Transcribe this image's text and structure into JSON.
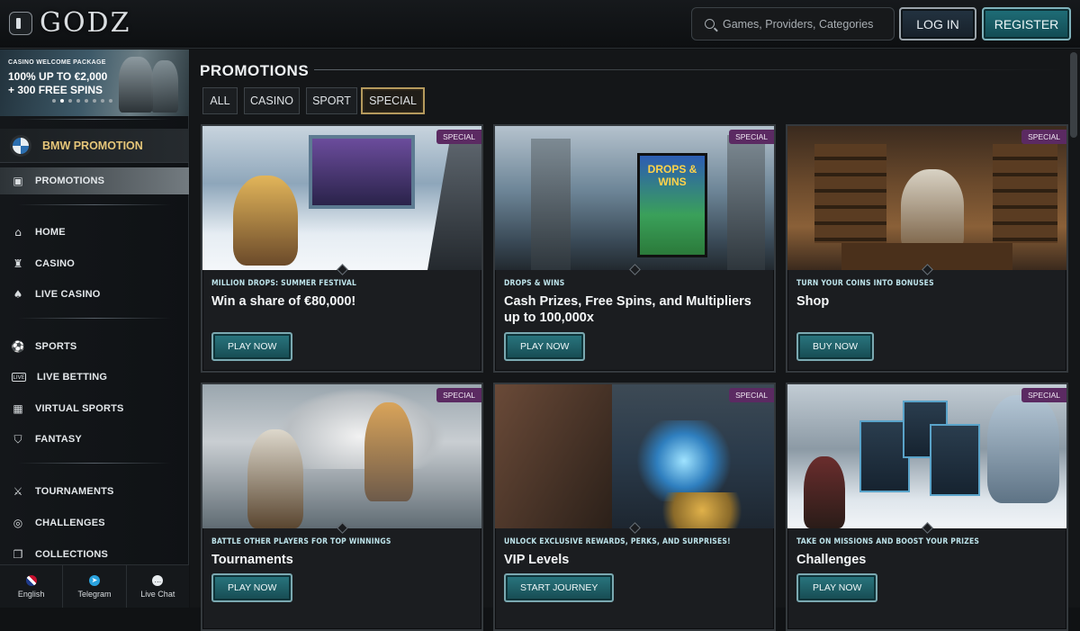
{
  "header": {
    "logo": "GODZ",
    "search_placeholder": "Games, Providers, Categories",
    "login_label": "LOG IN",
    "register_label": "REGISTER"
  },
  "sidebar": {
    "banner": {
      "title": "CASINO WELCOME PACKAGE",
      "line1": "100% UP TO €2,000",
      "line2": "+ 300 FREE SPINS",
      "slide_count": 8,
      "active_slide": 1
    },
    "bmw_promo": "BMW PROMOTION",
    "promotions": "PROMOTIONS",
    "items": [
      {
        "label": "HOME",
        "icon": "home-icon"
      },
      {
        "label": "CASINO",
        "icon": "casino-icon"
      },
      {
        "label": "LIVE CASINO",
        "icon": "live-casino-icon"
      },
      {
        "label": "SPORTS",
        "icon": "sports-icon"
      },
      {
        "label": "LIVE BETTING",
        "icon": "live-betting-icon"
      },
      {
        "label": "VIRTUAL SPORTS",
        "icon": "virtual-sports-icon"
      },
      {
        "label": "FANTASY",
        "icon": "fantasy-icon"
      },
      {
        "label": "TOURNAMENTS",
        "icon": "tournaments-icon"
      },
      {
        "label": "CHALLENGES",
        "icon": "challenges-icon"
      },
      {
        "label": "COLLECTIONS",
        "icon": "collections-icon"
      }
    ],
    "bottom": {
      "language": "English",
      "telegram": "Telegram",
      "live_chat": "Live Chat"
    }
  },
  "main": {
    "title": "PROMOTIONS",
    "filters": [
      "ALL",
      "CASINO",
      "SPORT",
      "SPECIAL"
    ],
    "active_filter": "SPECIAL",
    "cards": [
      {
        "badge": "SPECIAL",
        "subtitle": "MILLION DROPS: SUMMER FESTIVAL",
        "title": "Win a share of €80,000!",
        "button": "PLAY NOW"
      },
      {
        "badge": "SPECIAL",
        "subtitle": "DROPS & WINS",
        "title": "Cash Prizes, Free Spins, and Multipliers up to 100,000x",
        "button": "PLAY NOW"
      },
      {
        "badge": "SPECIAL",
        "subtitle": "TURN YOUR COINS INTO BONUSES",
        "title": "Shop",
        "button": "BUY NOW"
      },
      {
        "badge": "SPECIAL",
        "subtitle": "BATTLE OTHER PLAYERS FOR TOP WINNINGS",
        "title": "Tournaments",
        "button": "PLAY NOW"
      },
      {
        "badge": "SPECIAL",
        "subtitle": "UNLOCK EXCLUSIVE REWARDS, PERKS, AND SURPRISES!",
        "title": "VIP Levels",
        "button": "START JOURNEY"
      },
      {
        "badge": "SPECIAL",
        "subtitle": "TAKE ON MISSIONS AND BOOST YOUR PRIZES",
        "title": "Challenges",
        "button": "PLAY NOW"
      }
    ],
    "card_art": {
      "drops_wins_poster": "DROPS & WINS"
    }
  },
  "colors": {
    "accent_teal": "#1f6e78",
    "gold": "#e6c679",
    "badge_purple": "#5b2a62"
  }
}
